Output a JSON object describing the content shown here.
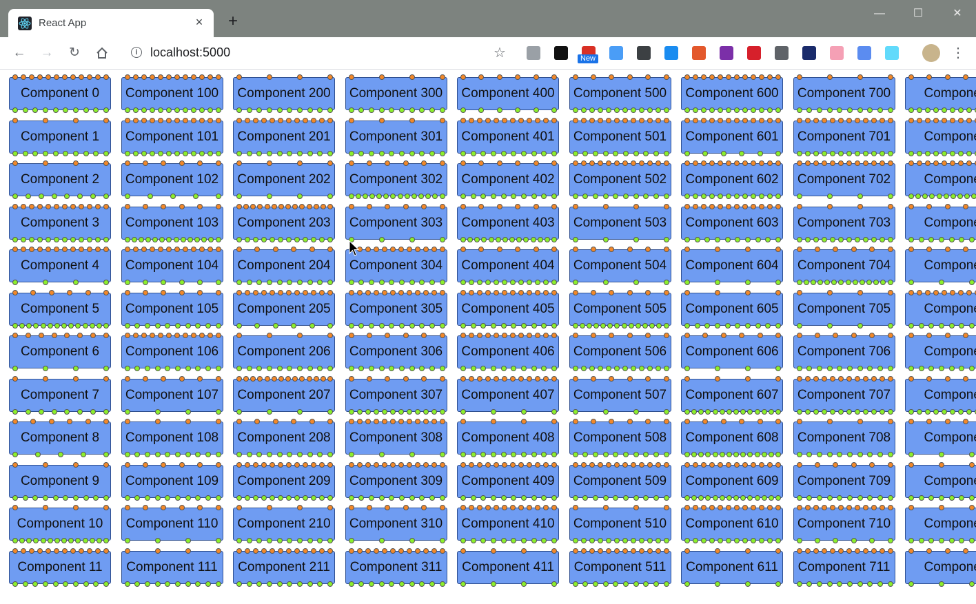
{
  "browser": {
    "tab_title": "React App",
    "tab_close": "×",
    "new_tab": "+",
    "url": "localhost:5000",
    "window_controls": {
      "minimize": "—",
      "maximize": "☐",
      "close": "✕"
    },
    "extensions": [
      {
        "name": "download-icon",
        "color": "#9aa0a6"
      },
      {
        "name": "circle-icon",
        "color": "#111111"
      },
      {
        "name": "chrome-new-icon",
        "color": "#d93025",
        "badge": "New"
      },
      {
        "name": "paperplane-icon",
        "color": "#4a9df6"
      },
      {
        "name": "dots-icon",
        "color": "#3c4043"
      },
      {
        "name": "windows-icon",
        "color": "#1a8cf0"
      },
      {
        "name": "office-icon",
        "color": "#e3582c"
      },
      {
        "name": "onenote-icon",
        "color": "#7b2fa8"
      },
      {
        "name": "mendeley-icon",
        "color": "#d6202b"
      },
      {
        "name": "sigma-icon",
        "color": "#5f6368"
      },
      {
        "name": "hash-icon",
        "color": "#1a2b6b"
      },
      {
        "name": "bilibili-icon",
        "color": "#f5a0b5"
      },
      {
        "name": "script-icon",
        "color": "#5b8cf0"
      },
      {
        "name": "react-devtools-icon",
        "color": "#61dafb"
      },
      {
        "name": "profile-avatar",
        "color": "#c8b48c"
      }
    ]
  },
  "accent": {
    "component_fill": "#6f9cf2",
    "input_port": "#f2882a",
    "output_port": "#8cef2c"
  },
  "components": [
    {
      "label": "Component 0",
      "in": 12,
      "out": 10
    },
    {
      "label": "Component 1",
      "in": 4,
      "out": 10
    },
    {
      "label": "Component 2",
      "in": 4,
      "out": 8
    },
    {
      "label": "Component 3",
      "in": 12,
      "out": 12
    },
    {
      "label": "Component 4",
      "in": 12,
      "out": 4
    },
    {
      "label": "Component 5",
      "in": 6,
      "out": 14
    },
    {
      "label": "Component 6",
      "in": 8,
      "out": 4
    },
    {
      "label": "Component 7",
      "in": 4,
      "out": 8
    },
    {
      "label": "Component 8",
      "in": 6,
      "out": 5
    },
    {
      "label": "Component 9",
      "in": 4,
      "out": 10
    },
    {
      "label": "Component 10",
      "in": 4,
      "out": 14
    },
    {
      "label": "Component 11",
      "in": 12,
      "out": 10
    },
    {
      "label": "Component 100",
      "in": 12,
      "out": 12
    },
    {
      "label": "Component 101",
      "in": 12,
      "out": 12
    },
    {
      "label": "Component 102",
      "in": 6,
      "out": 5
    },
    {
      "label": "Component 103",
      "in": 6,
      "out": 14
    },
    {
      "label": "Component 104",
      "in": 12,
      "out": 6
    },
    {
      "label": "Component 105",
      "in": 6,
      "out": 10
    },
    {
      "label": "Component 106",
      "in": 12,
      "out": 10
    },
    {
      "label": "Component 107",
      "in": 6,
      "out": 4
    },
    {
      "label": "Component 108",
      "in": 4,
      "out": 10
    },
    {
      "label": "Component 109",
      "in": 6,
      "out": 10
    },
    {
      "label": "Component 110",
      "in": 6,
      "out": 4
    },
    {
      "label": "Component 111",
      "in": 4,
      "out": 10
    },
    {
      "label": "Component 200",
      "in": 4,
      "out": 10
    },
    {
      "label": "Component 201",
      "in": 12,
      "out": 10
    },
    {
      "label": "Component 202",
      "in": 4,
      "out": 4
    },
    {
      "label": "Component 203",
      "in": 14,
      "out": 12
    },
    {
      "label": "Component 204",
      "in": 6,
      "out": 10
    },
    {
      "label": "Component 205",
      "in": 12,
      "out": 6
    },
    {
      "label": "Component 206",
      "in": 4,
      "out": 10
    },
    {
      "label": "Component 207",
      "in": 14,
      "out": 4
    },
    {
      "label": "Component 208",
      "in": 6,
      "out": 10
    },
    {
      "label": "Component 209",
      "in": 12,
      "out": 12
    },
    {
      "label": "Component 210",
      "in": 4,
      "out": 10
    },
    {
      "label": "Component 211",
      "in": 12,
      "out": 10
    },
    {
      "label": "Component 300",
      "in": 4,
      "out": 10
    },
    {
      "label": "Component 301",
      "in": 4,
      "out": 10
    },
    {
      "label": "Component 302",
      "in": 6,
      "out": 14
    },
    {
      "label": "Component 303",
      "in": 6,
      "out": 4
    },
    {
      "label": "Component 304",
      "in": 12,
      "out": 10
    },
    {
      "label": "Component 305",
      "in": 12,
      "out": 10
    },
    {
      "label": "Component 306",
      "in": 6,
      "out": 10
    },
    {
      "label": "Component 307",
      "in": 6,
      "out": 12
    },
    {
      "label": "Component 308",
      "in": 12,
      "out": 4
    },
    {
      "label": "Component 309",
      "in": 12,
      "out": 10
    },
    {
      "label": "Component 310",
      "in": 6,
      "out": 4
    },
    {
      "label": "Component 311",
      "in": 12,
      "out": 10
    },
    {
      "label": "Component 400",
      "in": 6,
      "out": 6
    },
    {
      "label": "Component 401",
      "in": 12,
      "out": 10
    },
    {
      "label": "Component 402",
      "in": 6,
      "out": 10
    },
    {
      "label": "Component 403",
      "in": 6,
      "out": 14
    },
    {
      "label": "Component 404",
      "in": 6,
      "out": 12
    },
    {
      "label": "Component 405",
      "in": 12,
      "out": 10
    },
    {
      "label": "Component 406",
      "in": 12,
      "out": 10
    },
    {
      "label": "Component 407",
      "in": 12,
      "out": 4
    },
    {
      "label": "Component 408",
      "in": 4,
      "out": 10
    },
    {
      "label": "Component 409",
      "in": 12,
      "out": 10
    },
    {
      "label": "Component 410",
      "in": 12,
      "out": 10
    },
    {
      "label": "Component 411",
      "in": 4,
      "out": 4
    },
    {
      "label": "Component 500",
      "in": 6,
      "out": 12
    },
    {
      "label": "Component 501",
      "in": 12,
      "out": 10
    },
    {
      "label": "Component 502",
      "in": 12,
      "out": 10
    },
    {
      "label": "Component 503",
      "in": 4,
      "out": 4
    },
    {
      "label": "Component 504",
      "in": 6,
      "out": 4
    },
    {
      "label": "Component 505",
      "in": 6,
      "out": 14
    },
    {
      "label": "Component 506",
      "in": 6,
      "out": 12
    },
    {
      "label": "Component 507",
      "in": 6,
      "out": 4
    },
    {
      "label": "Component 508",
      "in": 6,
      "out": 10
    },
    {
      "label": "Component 509",
      "in": 12,
      "out": 10
    },
    {
      "label": "Component 510",
      "in": 4,
      "out": 12
    },
    {
      "label": "Component 511",
      "in": 12,
      "out": 10
    },
    {
      "label": "Component 600",
      "in": 12,
      "out": 12
    },
    {
      "label": "Component 601",
      "in": 12,
      "out": 6
    },
    {
      "label": "Component 602",
      "in": 12,
      "out": 12
    },
    {
      "label": "Component 603",
      "in": 12,
      "out": 10
    },
    {
      "label": "Component 604",
      "in": 4,
      "out": 4
    },
    {
      "label": "Component 605",
      "in": 4,
      "out": 10
    },
    {
      "label": "Component 606",
      "in": 6,
      "out": 4
    },
    {
      "label": "Component 607",
      "in": 4,
      "out": 14
    },
    {
      "label": "Component 608",
      "in": 6,
      "out": 14
    },
    {
      "label": "Component 609",
      "in": 12,
      "out": 14
    },
    {
      "label": "Component 610",
      "in": 12,
      "out": 12
    },
    {
      "label": "Component 611",
      "in": 4,
      "out": 4
    },
    {
      "label": "Component 700",
      "in": 4,
      "out": 10
    },
    {
      "label": "Component 701",
      "in": 12,
      "out": 12
    },
    {
      "label": "Component 702",
      "in": 12,
      "out": 4
    },
    {
      "label": "Component 703",
      "in": 4,
      "out": 12
    },
    {
      "label": "Component 704",
      "in": 6,
      "out": 14
    },
    {
      "label": "Component 705",
      "in": 4,
      "out": 4
    },
    {
      "label": "Component 706",
      "in": 6,
      "out": 10
    },
    {
      "label": "Component 707",
      "in": 12,
      "out": 12
    },
    {
      "label": "Component 708",
      "in": 4,
      "out": 10
    },
    {
      "label": "Component 709",
      "in": 6,
      "out": 10
    },
    {
      "label": "Component 710",
      "in": 12,
      "out": 6
    },
    {
      "label": "Component 711",
      "in": 12,
      "out": 10
    },
    {
      "label": "Componen",
      "in": 6,
      "out": 12
    },
    {
      "label": "Componen",
      "in": 12,
      "out": 12
    },
    {
      "label": "Componen",
      "in": 12,
      "out": 14
    },
    {
      "label": "Componen",
      "in": 6,
      "out": 10
    },
    {
      "label": "Componen",
      "in": 6,
      "out": 4
    },
    {
      "label": "Componen",
      "in": 12,
      "out": 10
    },
    {
      "label": "Componen",
      "in": 6,
      "out": 10
    },
    {
      "label": "Componen",
      "in": 6,
      "out": 12
    },
    {
      "label": "Componen",
      "in": 6,
      "out": 4
    },
    {
      "label": "Componen",
      "in": 4,
      "out": 10
    },
    {
      "label": "Componen",
      "in": 4,
      "out": 10
    },
    {
      "label": "Componen",
      "in": 6,
      "out": 4
    }
  ]
}
